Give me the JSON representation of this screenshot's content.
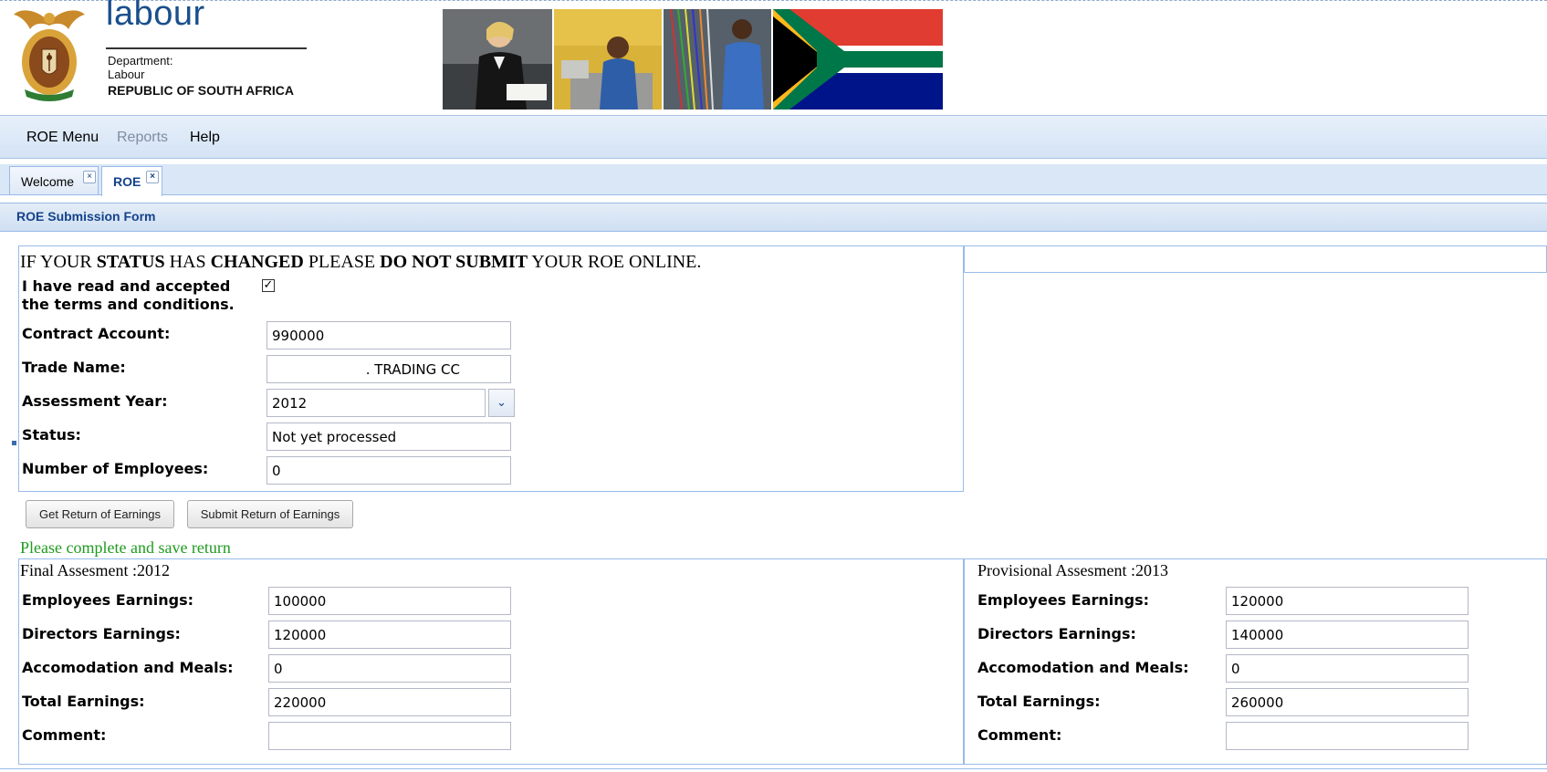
{
  "header": {
    "brand_title": "labour",
    "dept_line1": "Department:",
    "dept_line2": "Labour",
    "country": "REPUBLIC OF SOUTH AFRICA"
  },
  "menu": {
    "items": [
      {
        "label": "ROE Menu",
        "enabled": true
      },
      {
        "label": "Reports",
        "enabled": false
      },
      {
        "label": "Help",
        "enabled": true
      }
    ]
  },
  "tabs": [
    {
      "label": "Welcome",
      "active": false
    },
    {
      "label": "ROE",
      "active": true
    }
  ],
  "panel": {
    "title": "ROE Submission Form"
  },
  "notice": {
    "p1": "IF YOUR ",
    "b1": "STATUS",
    "p2": " HAS ",
    "b2": "CHANGED",
    "p3": " PLEASE ",
    "b3": "DO NOT SUBMIT",
    "p4": " YOUR ROE ONLINE."
  },
  "terms": {
    "label": "I have read and accepted the terms and conditions.",
    "checked": true,
    "check_glyph": "✓"
  },
  "form": {
    "contract_account": {
      "label": "Contract Account:",
      "value": "990000"
    },
    "trade_name": {
      "label": "Trade Name:",
      "value": ". TRADING CC"
    },
    "assessment_year": {
      "label": "Assessment Year:",
      "value": "2012"
    },
    "status": {
      "label": "Status:",
      "value": "Not yet processed"
    },
    "employees": {
      "label": "Number of Employees:",
      "value": "0"
    }
  },
  "buttons": {
    "get_roe": "Get Return of Earnings",
    "submit_roe": "Submit Return of Earnings"
  },
  "message": "Please complete and save return",
  "final_assessment": {
    "title": "Final Assesment :2012",
    "employees_earnings": {
      "label": "Employees Earnings:",
      "value": "100000"
    },
    "directors_earnings": {
      "label": "Directors Earnings:",
      "value": "120000"
    },
    "accommodation_meals": {
      "label": "Accomodation and Meals:",
      "value": "0"
    },
    "total_earnings": {
      "label": "Total Earnings:",
      "value": "220000"
    },
    "comment": {
      "label": "Comment:",
      "value": ""
    }
  },
  "provisional_assessment": {
    "title": "Provisional Assesment :2013",
    "employees_earnings": {
      "label": "Employees Earnings:",
      "value": "120000"
    },
    "directors_earnings": {
      "label": "Directors Earnings:",
      "value": "140000"
    },
    "accommodation_meals": {
      "label": "Accomodation and Meals:",
      "value": "0"
    },
    "total_earnings": {
      "label": "Total Earnings:",
      "value": "260000"
    },
    "comment": {
      "label": "Comment:",
      "value": ""
    }
  },
  "colors": {
    "brand_blue": "#1a4f8c",
    "panel_title": "#15428b",
    "message_green": "#1f9b1f",
    "border_blue": "#99bbe8"
  },
  "icons": {
    "coat_of_arms": "coat-of-arms-logo",
    "dropdown": "chevron-down-icon",
    "tab_close": "close-icon",
    "checkbox": "check-icon"
  }
}
